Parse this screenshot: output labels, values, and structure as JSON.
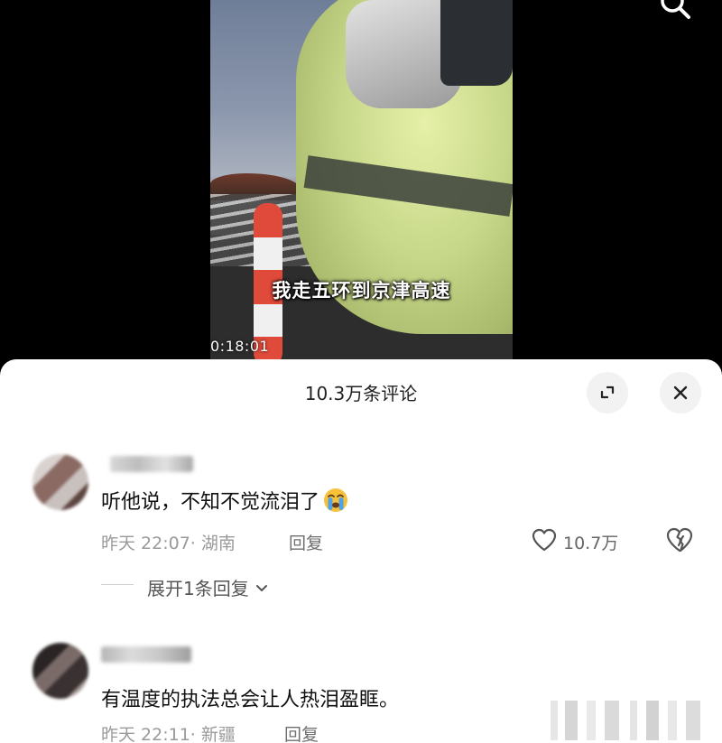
{
  "video": {
    "subtitle": "我走五环到京津高速",
    "timecode": "0:18:01"
  },
  "comments_panel": {
    "title": "10.3万条评论"
  },
  "comments": [
    {
      "text": "听他说，不知不觉流泪了",
      "emoji": "loudly-crying-face-icon",
      "meta": "昨天 22:07· 湖南",
      "reply_label": "回复",
      "likes": "10.7万",
      "expand_label": "展开1条回复"
    },
    {
      "text": "有温度的执法总会让人热泪盈眶。",
      "meta": "昨天 22:11· 新疆",
      "reply_label": "回复"
    }
  ],
  "colors": {
    "sheet_background": "#ffffff",
    "primary_text": "#111111",
    "secondary_text": "#9a9a9a",
    "button_background": "#f2f2f2"
  }
}
